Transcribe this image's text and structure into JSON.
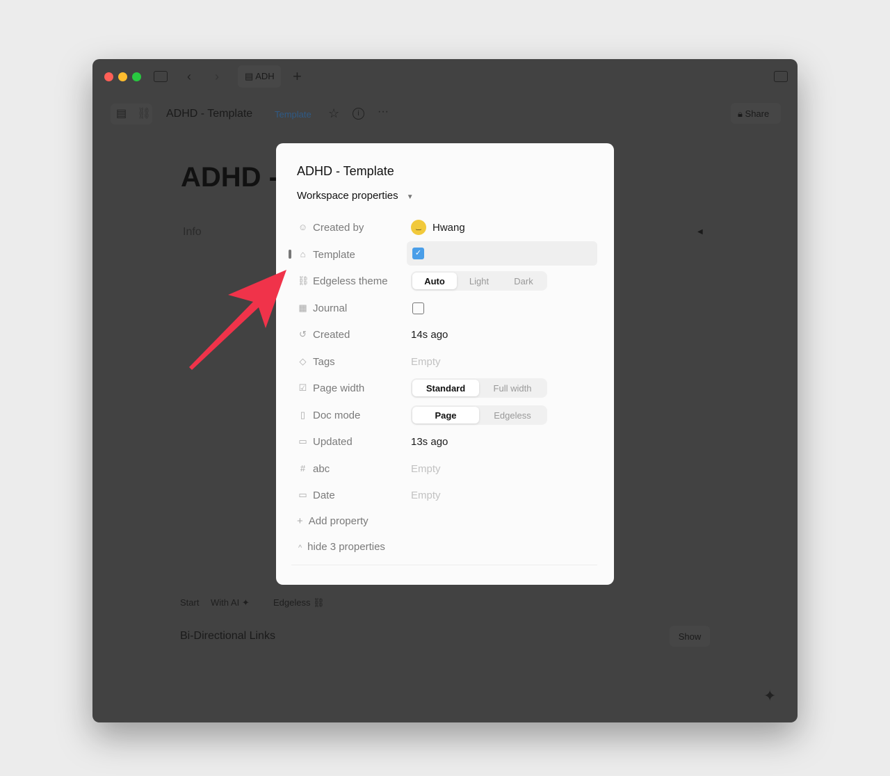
{
  "titlebar": {
    "tab_label": "ADH",
    "traffic_colors": [
      "#ff5f57",
      "#febc2e",
      "#28c840"
    ]
  },
  "header": {
    "doc_title": "ADHD - Template",
    "template_badge": "Template",
    "share_label": "Share",
    "badge_color": "#2f5a85"
  },
  "page": {
    "big_title": "ADHD -",
    "info_label": "Info",
    "start_label": "Start",
    "with_ai_label": "With AI",
    "edgeless_label": "Edgeless",
    "bilinks_label": "Bi-Directional Links",
    "show_label": "Show"
  },
  "modal": {
    "title": "ADHD - Template",
    "section": "Workspace properties",
    "properties": [
      {
        "icon": "person-icon",
        "label": "Created by",
        "type": "person",
        "value": "Hwang"
      },
      {
        "icon": "template-icon",
        "label": "Template",
        "type": "checkbox",
        "checked": true
      },
      {
        "icon": "edgeless-icon",
        "label": "Edgeless theme",
        "type": "segmented",
        "options": [
          "Auto",
          "Light",
          "Dark"
        ],
        "selected": "Auto"
      },
      {
        "icon": "journal-icon",
        "label": "Journal",
        "type": "checkbox",
        "checked": false
      },
      {
        "icon": "history-icon",
        "label": "Created",
        "type": "text",
        "value": "14s ago"
      },
      {
        "icon": "tag-icon",
        "label": "Tags",
        "type": "empty",
        "value": "Empty"
      },
      {
        "icon": "checkbox-icon",
        "label": "Page width",
        "type": "segmented",
        "options": [
          "Standard",
          "Full width"
        ],
        "selected": "Standard"
      },
      {
        "icon": "doc-icon",
        "label": "Doc mode",
        "type": "segmented",
        "options": [
          "Page",
          "Edgeless"
        ],
        "selected": "Page"
      },
      {
        "icon": "calendar-icon",
        "label": "Updated",
        "type": "text",
        "value": "13s ago"
      },
      {
        "icon": "hash-icon",
        "label": "abc",
        "type": "empty",
        "value": "Empty"
      },
      {
        "icon": "calendar-icon",
        "label": "Date",
        "type": "empty",
        "value": "Empty"
      }
    ],
    "add_property": "Add property",
    "hide_properties": "hide 3 properties",
    "checkbox_color": "#4a9ee8"
  },
  "annotation": {
    "arrow_color": "#f0334a"
  }
}
